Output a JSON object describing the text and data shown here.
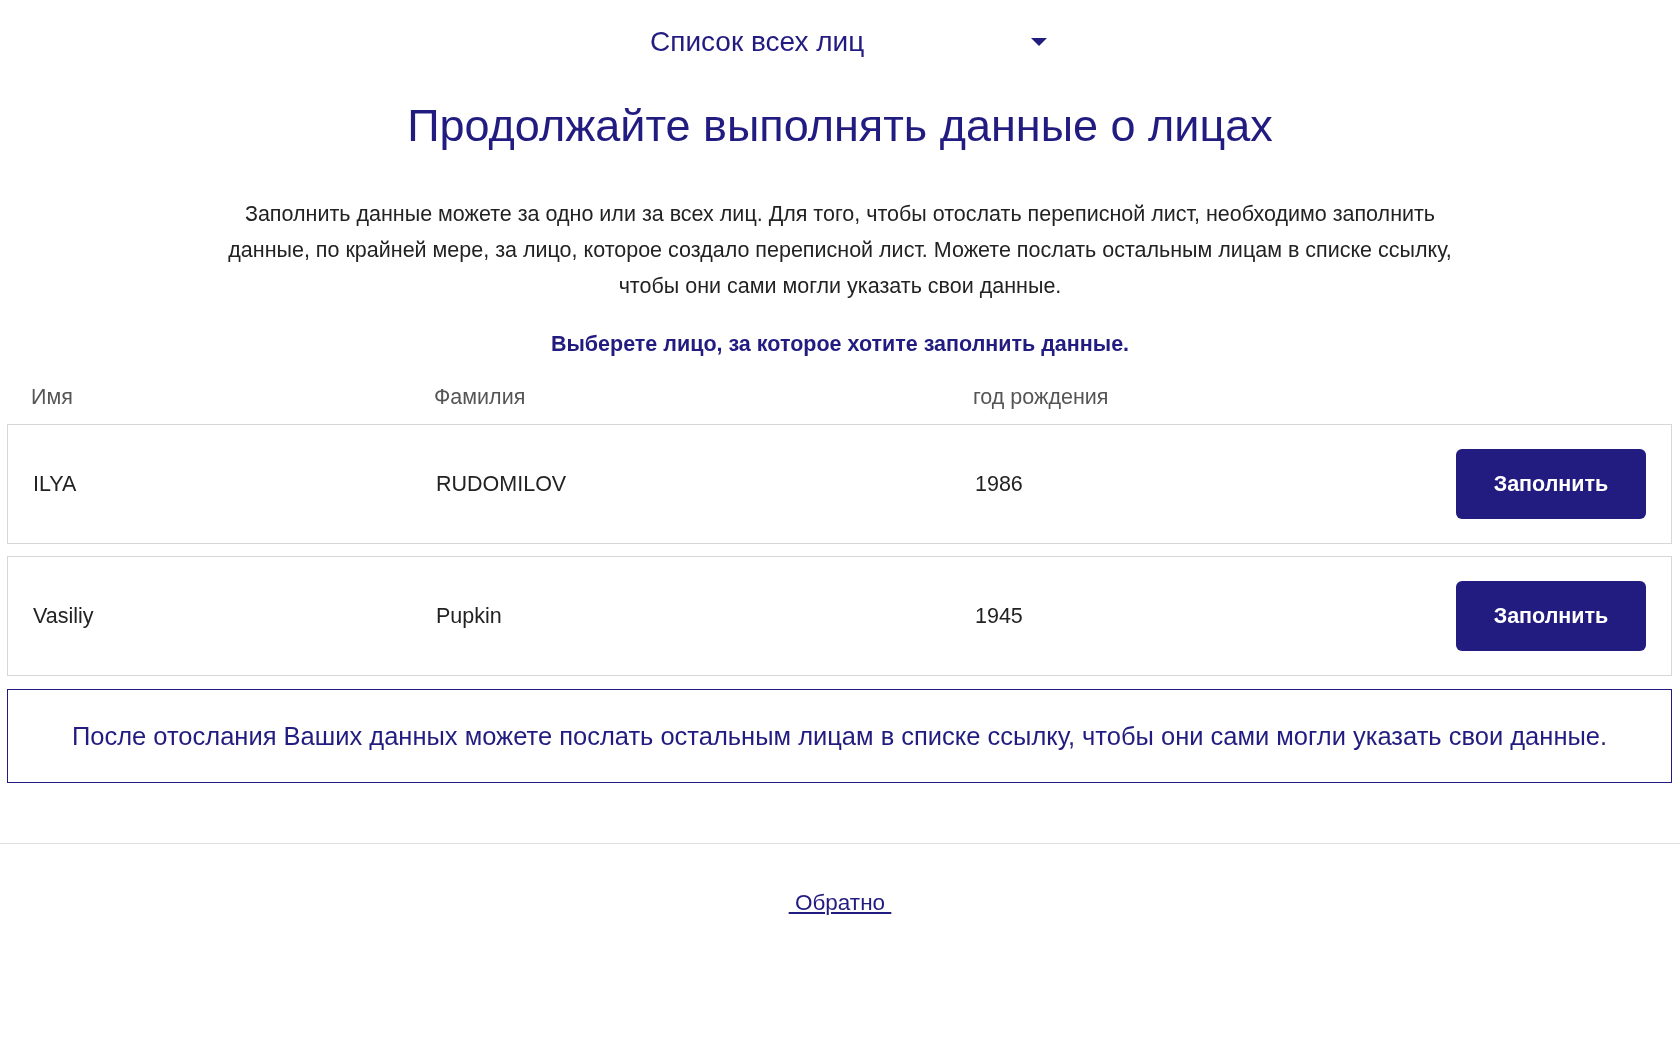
{
  "dropdown": {
    "value": "Список всех лиц"
  },
  "heading": "Продолжайте выполнять данные о лицах",
  "intro": "Заполнить данные можете за одно или за всех лиц. Для того, чтобы отослать переписной лист, необходимо заполнить данные, по крайней мере, за лицо, которое создало переписной лист. Можете послать остальным лицам в списке ссылку, чтобы они сами могли указать свои данные.",
  "prompt": "Выберете лицо, за которое хотите заполнить данные.",
  "table": {
    "columns": [
      "Имя",
      "Фамилия",
      "год рождения"
    ],
    "rows": [
      {
        "first_name": "ILYA",
        "last_name": "RUDOMILOV",
        "birth_year": "1986",
        "button": "Заполнить"
      },
      {
        "first_name": "Vasiliy",
        "last_name": "Pupkin",
        "birth_year": "1945",
        "button": "Заполнить"
      }
    ]
  },
  "notice": "После отослания Ваших данных можете послать остальным лицам в списке ссылку, чтобы они сами могли указать свои данные.",
  "back_link": "Обратно"
}
